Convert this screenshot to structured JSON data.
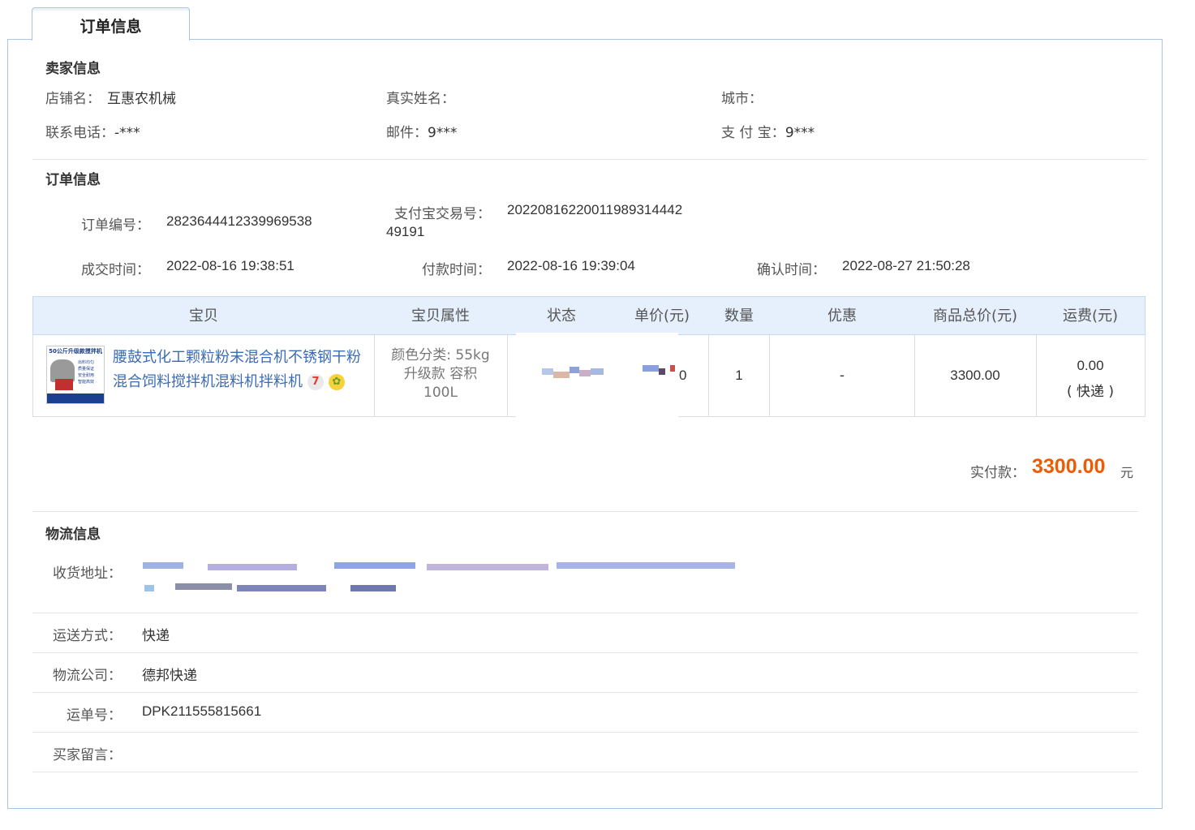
{
  "tab": {
    "label": "订单信息"
  },
  "seller": {
    "title": "卖家信息",
    "shop_label": "店铺名：",
    "shop_value": "互惠农机械",
    "realname_label": "真实姓名：",
    "realname_value": "",
    "city_label": "城市：",
    "city_value": "",
    "phone_label": "联系电话：",
    "phone_value": "-***",
    "email_label": "邮件：",
    "email_value": "9***",
    "alipay_label": "支 付 宝：",
    "alipay_value": "9***"
  },
  "order": {
    "title": "订单信息",
    "order_no_label": "订单编号：",
    "order_no_value": "2823644412339969538",
    "trade_no_label": "支付宝交易号：",
    "trade_no_line1": "20220816220011989314442",
    "trade_no_line2": "49191",
    "deal_time_label": "成交时间：",
    "deal_time_value": "2022-08-16 19:38:51",
    "pay_time_label": "付款时间：",
    "pay_time_value": "2022-08-16 19:39:04",
    "confirm_time_label": "确认时间：",
    "confirm_time_value": "2022-08-27 21:50:28"
  },
  "table": {
    "headers": [
      "宝贝",
      "宝贝属性",
      "状态",
      "单价(元)",
      "数量",
      "优惠",
      "商品总价(元)",
      "运费(元)"
    ],
    "row": {
      "product_name": "腰鼓式化工颗粒粉末混合机不锈钢干粉混合饲料搅拌机混料机拌料机",
      "thumb_caption": "50公斤升级款搅拌机",
      "thumb_lines": [
        "出料均匀",
        "质量保证",
        "安全耐用",
        "智能高效"
      ],
      "attr_line1": "颜色分类: 55kg",
      "attr_line2": "升级款 容积",
      "attr_line3": "100L",
      "price_partial": "0",
      "quantity": "1",
      "discount": "-",
      "total": "3300.00",
      "shipping_fee": "0.00",
      "shipping_method": "( 快递 )"
    }
  },
  "payment": {
    "label": "实付款：",
    "amount": "3300.00",
    "unit": "元",
    "accent_color": "#f05a00"
  },
  "logistics": {
    "title": "物流信息",
    "address_label": "收货地址：",
    "method_label": "运送方式：",
    "method_value": "快递",
    "company_label": "物流公司：",
    "company_value": "德邦快递",
    "waybill_label": "运单号：",
    "waybill_value": "DPK211555815661",
    "message_label": "买家留言：",
    "message_value": ""
  },
  "colors": {
    "link": "#3c6bb5",
    "border": "#aac6e3",
    "header_bg": "#e5f0fc"
  }
}
